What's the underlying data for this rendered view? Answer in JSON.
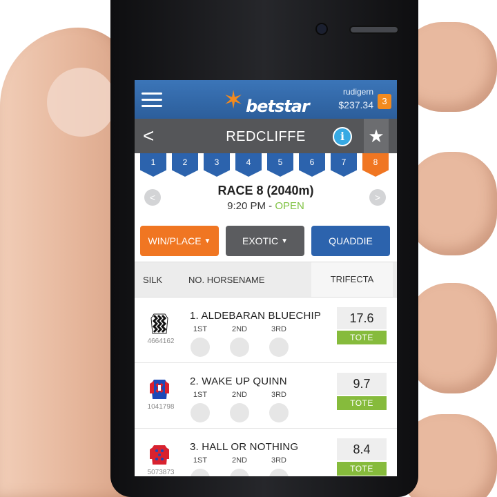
{
  "colors": {
    "brand_blue": "#2c63ad",
    "brand_orange": "#f07622",
    "open_green": "#7fc241",
    "tote_green": "#86bb3c"
  },
  "header": {
    "menu_icon": "hamburger-icon",
    "logo_text": "betstar",
    "username": "rudigern",
    "balance": "$237.34",
    "notification_count": "3"
  },
  "meeting": {
    "back_icon": "chevron-left-icon",
    "back_glyph": "<",
    "title": "REDCLIFFE",
    "info_glyph": "i",
    "favorite_glyph": "★"
  },
  "race_tabs": [
    "1",
    "2",
    "3",
    "4",
    "5",
    "6",
    "7",
    "8"
  ],
  "active_race": "8",
  "race": {
    "name": "RACE 8 (2040m)",
    "time": "9:20 PM",
    "separator": " - ",
    "status": "OPEN",
    "prev_glyph": "<",
    "next_glyph": ">"
  },
  "bet_types": {
    "win_place": "WIN/PLACE",
    "exotic": "EXOTIC",
    "quaddie": "QUADDIE",
    "caret": "▼"
  },
  "columns": {
    "silk": "SILK",
    "horse": "NO. HORSENAME",
    "bet": "TRIFECTA"
  },
  "runners": [
    {
      "name": "1. ALDEBARAN BLUECHIP",
      "silk_id": "4664162",
      "positions": [
        "1ST",
        "2ND",
        "3RD"
      ],
      "odds": "17.6",
      "tote": "TOTE"
    },
    {
      "name": "2. WAKE UP QUINN",
      "silk_id": "1041798",
      "positions": [
        "1ST",
        "2ND",
        "3RD"
      ],
      "odds": "9.7",
      "tote": "TOTE"
    },
    {
      "name": "3. HALL OR NOTHING",
      "silk_id": "5073873",
      "positions": [
        "1ST",
        "2ND",
        "3RD"
      ],
      "odds": "8.4",
      "tote": "TOTE"
    }
  ]
}
